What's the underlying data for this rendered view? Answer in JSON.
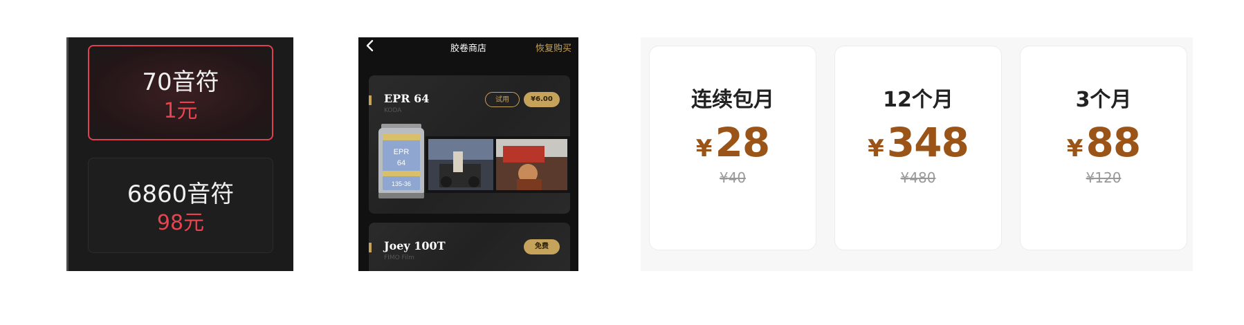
{
  "notes_panel": {
    "options": [
      {
        "quantity": "70音符",
        "price": "1元"
      },
      {
        "quantity": "6860音符",
        "price": "98元"
      }
    ]
  },
  "film_store": {
    "back_icon": "chevron-left-icon",
    "title": "胶卷商店",
    "restore_label": "恢复购买",
    "films": [
      {
        "name": "EPR 64",
        "brand": "KODA",
        "trial_label": "试用",
        "price_label": "¥6.00"
      },
      {
        "name": "Joey 100T",
        "brand": "FIMO Film",
        "price_label": "免费"
      }
    ],
    "canister_text": {
      "name": "EPR",
      "speed": "64",
      "code": "135-36"
    },
    "accent_color": "#c6a35a"
  },
  "membership": {
    "plans": [
      {
        "name": "连续包月",
        "currency": "¥",
        "price": "28",
        "original": "¥40"
      },
      {
        "name": "12个月",
        "currency": "¥",
        "price": "348",
        "original": "¥480"
      },
      {
        "name": "3个月",
        "currency": "¥",
        "price": "88",
        "original": "¥120"
      }
    ],
    "price_color": "#9a5418"
  }
}
